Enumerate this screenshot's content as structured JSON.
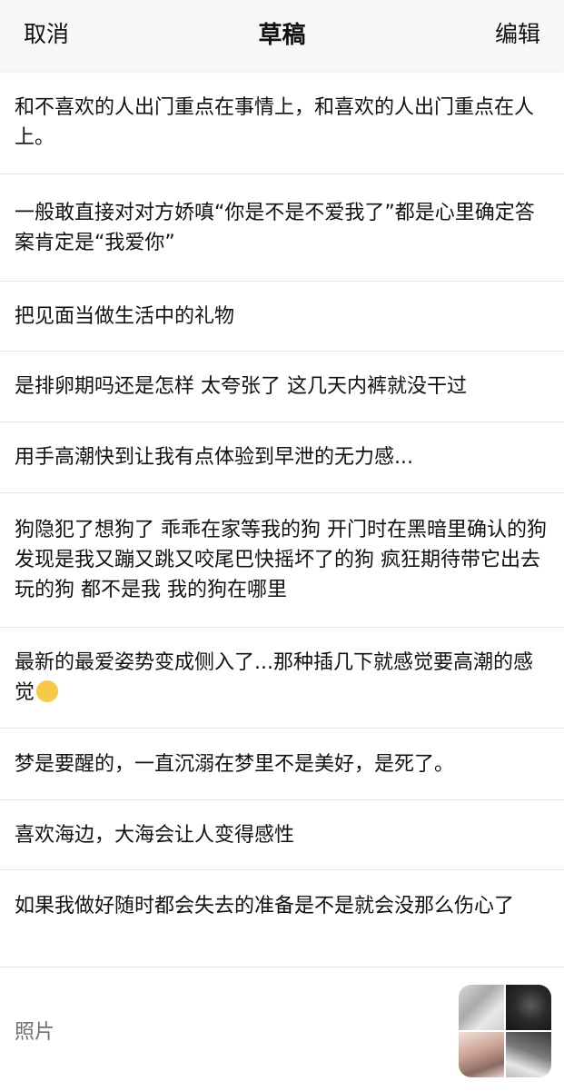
{
  "header": {
    "cancel_label": "取消",
    "title": "草稿",
    "edit_label": "编辑",
    "background": "#f7f7f7"
  },
  "drafts": [
    {
      "text": "和不喜欢的人出门重点在事情上，和喜欢的人出门重点在人上。"
    },
    {
      "text": "一般敢直接对对方娇嗔“你是不是不爱我了”都是心里确定答案肯定是“我爱你”"
    },
    {
      "text": "把见面当做生活中的礼物"
    },
    {
      "text": "是排卵期吗还是怎样 太夸张了 这几天内裤就没干过"
    },
    {
      "text": "用手高潮快到让我有点体验到早泄的无力感..."
    },
    {
      "text": "狗隐犯了想狗了 乖乖在家等我的狗 开门时在黑暗里确认的狗 发现是我又蹦又跳又咬尾巴快摇坏了的狗 疯狂期待带它出去玩的狗 都不是我 我的狗在哪里"
    },
    {
      "text": "最新的最爱姿势变成侧入了...那种插几下就感觉要高潮的感觉",
      "emoji": "pleading-face-emoji"
    },
    {
      "text": "梦是要醒的，一直沉溺在梦里不是美好，是死了。"
    },
    {
      "text": "喜欢海边，大海会让人变得感性"
    },
    {
      "text": "如果我做好随时都会失去的准备是不是就会没那么伤心了"
    }
  ],
  "photos": {
    "label": "照片",
    "thumbnail_icons": [
      "photo-thumbnail",
      "photo-thumbnail",
      "photo-thumbnail",
      "photo-thumbnail"
    ]
  },
  "colors": {
    "text": "#111111",
    "divider": "#e3e3e3",
    "muted": "#6e6e6e"
  }
}
